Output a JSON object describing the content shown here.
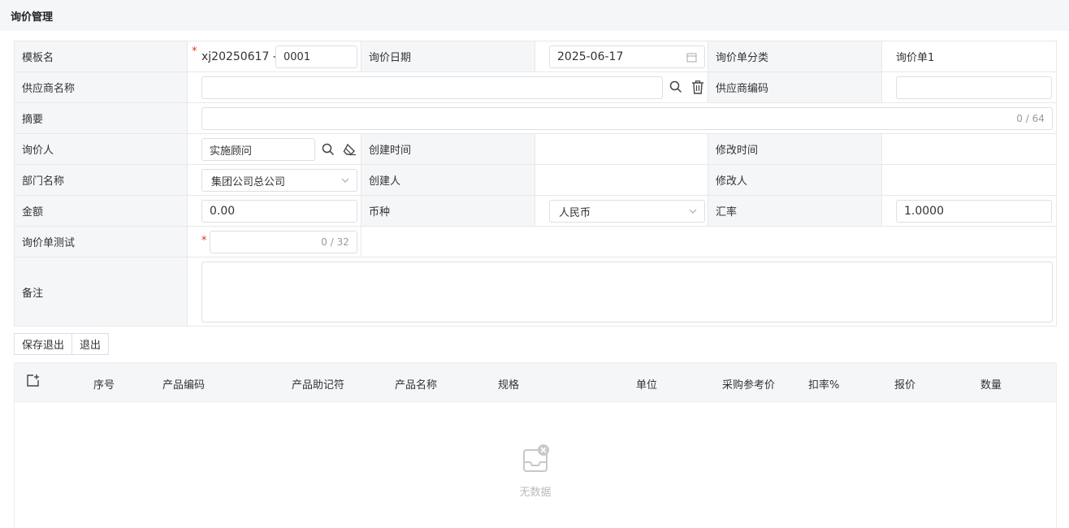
{
  "page": {
    "title": "询价管理"
  },
  "form": {
    "template_name_label": "模板名",
    "template_prefix": "xj20250617 -",
    "template_suffix": "0001",
    "inquiry_date_label": "询价日期",
    "inquiry_date": "2025-06-17",
    "category_label": "询价单分类",
    "category_value": "询价单1",
    "supplier_name_label": "供应商名称",
    "supplier_name": "",
    "supplier_code_label": "供应商编码",
    "supplier_code": "",
    "summary_label": "摘要",
    "summary_counter": "0 / 64",
    "inquirer_label": "询价人",
    "inquirer": "实施顾问",
    "created_time_label": "创建时间",
    "modified_time_label": "修改时间",
    "dept_label": "部门名称",
    "dept": "集团公司总公司",
    "creator_label": "创建人",
    "modifier_label": "修改人",
    "amount_label": "金额",
    "amount": "0.00",
    "currency_label": "币种",
    "currency": "人民币",
    "rate_label": "汇率",
    "rate": "1.0000",
    "test_label": "询价单测试",
    "test_counter": "0 / 32",
    "remark_label": "备注"
  },
  "buttons": {
    "save_exit": "保存退出",
    "exit": "退出"
  },
  "table": {
    "columns": [
      "序号",
      "产品编码",
      "产品助记符",
      "产品名称",
      "规格",
      "单位",
      "采购参考价",
      "扣率%",
      "报价",
      "数量"
    ],
    "empty_text": "无数据"
  },
  "icons": {
    "search": "search-icon",
    "delete": "trash-icon",
    "clear": "eraser-icon",
    "calendar": "calendar-icon",
    "dropdown": "chevron-down-icon",
    "add": "add-row-icon",
    "empty": "empty-inbox-icon"
  },
  "colors": {
    "required": "#e0312c",
    "label_bg": "#f5f6f8",
    "border": "#e8e8e8"
  }
}
